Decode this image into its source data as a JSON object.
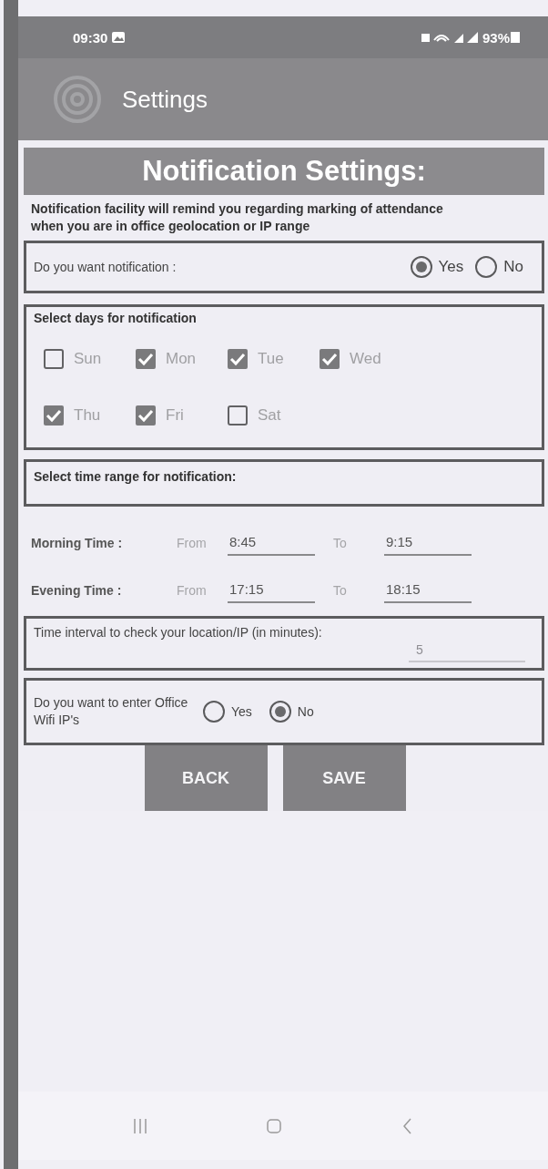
{
  "status_bar": {
    "time": "09:30",
    "battery": "93%"
  },
  "app_bar": {
    "title": "Settings"
  },
  "heading": "Notification Settings:",
  "description": "Notification facility will remind you regarding marking of attendance when you are in office geolocation or IP range",
  "notification_question": {
    "label": "Do you want notification :",
    "options": [
      {
        "label": "Yes",
        "selected": true
      },
      {
        "label": "No",
        "selected": false
      }
    ]
  },
  "days": {
    "title": "Select days for notification",
    "items": [
      {
        "label": "Sun",
        "checked": false
      },
      {
        "label": "Mon",
        "checked": true
      },
      {
        "label": "Tue",
        "checked": true
      },
      {
        "label": "Wed",
        "checked": true
      },
      {
        "label": "Thu",
        "checked": true
      },
      {
        "label": "Fri",
        "checked": true
      },
      {
        "label": "Sat",
        "checked": false
      }
    ]
  },
  "time_range": {
    "title": "Select time range for notification:",
    "rows": [
      {
        "label": "Morning Time :",
        "from_label": "From",
        "from": "8:45",
        "to_label": "To",
        "to": "9:15"
      },
      {
        "label": "Evening Time :",
        "from_label": "From",
        "from": "17:15",
        "to_label": "To",
        "to": "18:15"
      }
    ]
  },
  "interval": {
    "label": "Time interval to check your location/IP (in minutes):",
    "value": "5"
  },
  "wifi_question": {
    "label": "Do you want to enter Office Wifi IP's",
    "options": [
      {
        "label": "Yes",
        "selected": false
      },
      {
        "label": "No",
        "selected": true
      }
    ]
  },
  "buttons": [
    "BACK",
    "SAVE"
  ]
}
